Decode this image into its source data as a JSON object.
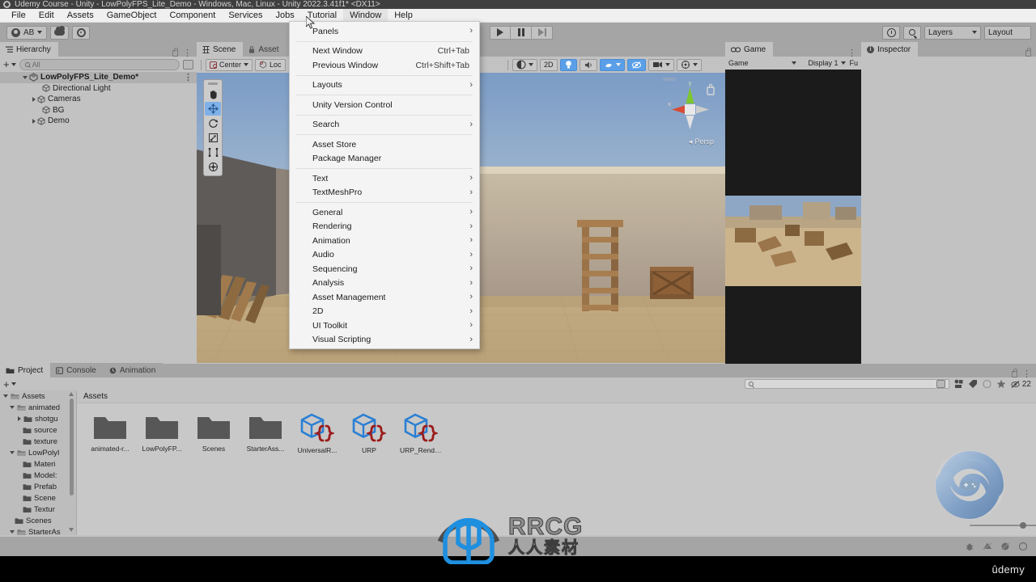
{
  "titlebar": {
    "text": "Udemy Course - Unity - LowPolyFPS_Lite_Demo - Windows, Mac, Linux - Unity 2022.3.41f1* <DX11>",
    "logo_icon": "unity-logo-icon"
  },
  "menubar": {
    "items": [
      {
        "label": "File",
        "active": false
      },
      {
        "label": "Edit",
        "active": false
      },
      {
        "label": "Assets",
        "active": false
      },
      {
        "label": "GameObject",
        "active": false
      },
      {
        "label": "Component",
        "active": false
      },
      {
        "label": "Services",
        "active": false
      },
      {
        "label": "Jobs",
        "active": false
      },
      {
        "label": "Tutorial",
        "active": false
      },
      {
        "label": "Window",
        "active": true
      },
      {
        "label": "Help",
        "active": false
      }
    ]
  },
  "toolbar": {
    "account_label": "AB",
    "account_icon": "person-icon",
    "cloud_icon": "cloud-icon",
    "settings_icon": "unity-services-icon",
    "play_icon": "play-icon",
    "pause_icon": "pause-icon",
    "step_icon": "step-icon",
    "history_icon": "undo-history-icon",
    "search_icon": "search-icon",
    "layers_label": "Layers",
    "layout_label": "Layout"
  },
  "window_menu": {
    "items": [
      {
        "label": "Panels",
        "shortcut": "",
        "submenu": true
      },
      {
        "sep": true
      },
      {
        "label": "Next Window",
        "shortcut": "Ctrl+Tab",
        "submenu": false
      },
      {
        "label": "Previous Window",
        "shortcut": "Ctrl+Shift+Tab",
        "submenu": false
      },
      {
        "sep": true
      },
      {
        "label": "Layouts",
        "shortcut": "",
        "submenu": true
      },
      {
        "sep": true
      },
      {
        "label": "Unity Version Control",
        "shortcut": "",
        "submenu": false
      },
      {
        "sep": true
      },
      {
        "label": "Search",
        "shortcut": "",
        "submenu": true
      },
      {
        "sep": true
      },
      {
        "label": "Asset Store",
        "shortcut": "",
        "submenu": false
      },
      {
        "label": "Package Manager",
        "shortcut": "",
        "submenu": false
      },
      {
        "sep": true
      },
      {
        "label": "Text",
        "shortcut": "",
        "submenu": true
      },
      {
        "label": "TextMeshPro",
        "shortcut": "",
        "submenu": true
      },
      {
        "sep": true
      },
      {
        "label": "General",
        "shortcut": "",
        "submenu": true
      },
      {
        "label": "Rendering",
        "shortcut": "",
        "submenu": true
      },
      {
        "label": "Animation",
        "shortcut": "",
        "submenu": true
      },
      {
        "label": "Audio",
        "shortcut": "",
        "submenu": true
      },
      {
        "label": "Sequencing",
        "shortcut": "",
        "submenu": true
      },
      {
        "label": "Analysis",
        "shortcut": "",
        "submenu": true
      },
      {
        "label": "Asset Management",
        "shortcut": "",
        "submenu": true
      },
      {
        "label": "2D",
        "shortcut": "",
        "submenu": true
      },
      {
        "label": "UI Toolkit",
        "shortcut": "",
        "submenu": true
      },
      {
        "label": "Visual Scripting",
        "shortcut": "",
        "submenu": true
      }
    ]
  },
  "hierarchy": {
    "tab_label": "Hierarchy",
    "tab_icon": "hierarchy-icon",
    "add_label": "+",
    "search_placeholder": "All",
    "search_value": "",
    "items": [
      {
        "label": "LowPolyFPS_Lite_Demo*",
        "depth": 0,
        "expanded": true,
        "selected": true,
        "icon": "unity-scene-icon",
        "root": true
      },
      {
        "label": "Directional Light",
        "depth": 1,
        "expanded": null,
        "selected": false,
        "icon": "gameobject-icon",
        "root": false
      },
      {
        "label": "Cameras",
        "depth": 1,
        "expanded": false,
        "selected": false,
        "icon": "gameobject-icon",
        "root": false
      },
      {
        "label": "BG",
        "depth": 1,
        "expanded": null,
        "selected": false,
        "icon": "gameobject-icon",
        "root": false
      },
      {
        "label": "Demo",
        "depth": 1,
        "expanded": false,
        "selected": false,
        "icon": "gameobject-icon",
        "root": false
      }
    ]
  },
  "scene": {
    "tabs": [
      {
        "label": "Scene",
        "icon": "scene-icon",
        "selected": true
      },
      {
        "label": "Asset",
        "icon": "asset-store-icon",
        "selected": false
      }
    ],
    "pivot_label": "Center",
    "rotation_label": "Loc",
    "view_mode_label": "2D",
    "draw_mode_icon": "shaded-icon",
    "lighting_icon": "light-bulb-icon",
    "audio_icon": "audio-icon",
    "fx_icon": "effects-icon",
    "hidden_icon": "hidden-objects-icon",
    "camera_icon": "scene-camera-icon",
    "gizmos_icon": "gizmos-icon",
    "persp_label": "Persp",
    "gizmo_axes": {
      "x": "x",
      "y": "y"
    },
    "tools": [
      {
        "name": "hand-tool",
        "active": false
      },
      {
        "name": "move-tool",
        "active": true
      },
      {
        "name": "rotate-tool",
        "active": false
      },
      {
        "name": "scale-tool",
        "active": false
      },
      {
        "name": "rect-tool",
        "active": false
      },
      {
        "name": "transform-tool",
        "active": false
      }
    ]
  },
  "game": {
    "tab_label": "Game",
    "tab_icon": "game-icon",
    "aspect_label": "Game",
    "display_label": "Display 1",
    "scale_label": "Fu"
  },
  "inspector": {
    "tab_label": "Inspector",
    "tab_icon": "info-icon",
    "lock_icon": "lock-icon"
  },
  "project": {
    "tabs": [
      {
        "label": "Project",
        "icon": "folder-icon",
        "selected": true
      },
      {
        "label": "Console",
        "icon": "console-icon",
        "selected": false
      },
      {
        "label": "Animation",
        "icon": "animation-icon",
        "selected": false
      }
    ],
    "add_label": "+",
    "breadcrumb": "Assets",
    "search_placeholder": "",
    "search_value": "",
    "badge_count": "22",
    "tree": [
      {
        "label": "Assets",
        "depth": 0,
        "expanded": true,
        "open_folder": true
      },
      {
        "label": "animated",
        "depth": 1,
        "expanded": true,
        "open_folder": true
      },
      {
        "label": "shotgu",
        "depth": 2,
        "expanded": false,
        "open_folder": false
      },
      {
        "label": "source",
        "depth": 2,
        "expanded": null,
        "open_folder": false
      },
      {
        "label": "texture",
        "depth": 2,
        "expanded": null,
        "open_folder": false
      },
      {
        "label": "LowPolyI",
        "depth": 1,
        "expanded": true,
        "open_folder": true
      },
      {
        "label": "Materi",
        "depth": 2,
        "expanded": null,
        "open_folder": false
      },
      {
        "label": "Model:",
        "depth": 2,
        "expanded": null,
        "open_folder": false
      },
      {
        "label": "Prefab",
        "depth": 2,
        "expanded": null,
        "open_folder": false
      },
      {
        "label": "Scene",
        "depth": 2,
        "expanded": null,
        "open_folder": false
      },
      {
        "label": "Textur",
        "depth": 2,
        "expanded": null,
        "open_folder": false
      },
      {
        "label": "Scenes",
        "depth": 1,
        "expanded": null,
        "open_folder": false
      },
      {
        "label": "StarterAs",
        "depth": 1,
        "expanded": true,
        "open_folder": true
      }
    ],
    "assets": [
      {
        "label": "animated-r...",
        "type": "folder"
      },
      {
        "label": "LowPolyFP...",
        "type": "folder"
      },
      {
        "label": "Scenes",
        "type": "folder"
      },
      {
        "label": "StarterAss...",
        "type": "folder"
      },
      {
        "label": "UniversalR...",
        "type": "scriptable-object"
      },
      {
        "label": "URP",
        "type": "scriptable-object"
      },
      {
        "label": "URP_Rende...",
        "type": "scriptable-object"
      }
    ],
    "toolbar_icons": [
      "save-search-icon",
      "filter-by-type-icon",
      "filter-by-label-icon",
      "filter-by-scene-icon",
      "favorites-icon",
      "hidden-packages-icon"
    ]
  },
  "statusbar": {
    "icons": [
      "bug-icon",
      "warning-icon",
      "error-icon",
      "more-icon"
    ]
  },
  "watermarks": {
    "rrcg_en": "RRCG",
    "rrcg_cn": "人人素材",
    "udemy": "ûdemy",
    "swirl_icon": "game-controller-swirl-icon"
  },
  "colors": {
    "accent_blue": "#5a9fe8",
    "panel_bg": "#c2c2c2",
    "toolbar_bg": "#a5a5a5",
    "menu_bg": "#f4f4f4",
    "asset_blue": "#2a7fd4",
    "asset_red": "#9b1c1c",
    "sky": "#7e9ec4",
    "ground": "#c7b089"
  }
}
